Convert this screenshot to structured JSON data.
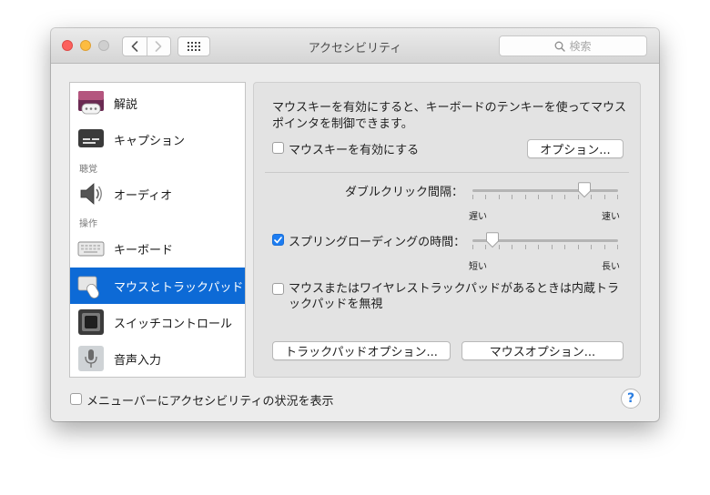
{
  "window": {
    "title": "アクセシビリティ",
    "search_placeholder": "検索"
  },
  "sidebar": {
    "items": [
      {
        "label": "解説",
        "icon": "descriptions-icon"
      },
      {
        "label": "キャプション",
        "icon": "captions-icon"
      },
      {
        "label": "オーディオ",
        "icon": "speaker-icon"
      },
      {
        "label": "キーボード",
        "icon": "keyboard-icon"
      },
      {
        "label": "マウスとトラックパッド",
        "icon": "mouse-trackpad-icon",
        "selected": true
      },
      {
        "label": "スイッチコントロール",
        "icon": "switch-control-icon"
      },
      {
        "label": "音声入力",
        "icon": "microphone-icon"
      }
    ],
    "headers": {
      "hearing": "聴覚",
      "interaction": "操作"
    }
  },
  "panel": {
    "description": "マウスキーを有効にすると、キーボードのテンキーを使ってマウスポインタを制御できます。",
    "mouse_keys_label": "マウスキーを有効にする",
    "mouse_keys_checked": false,
    "options_button": "オプション...",
    "double_click": {
      "label": "ダブルクリック間隔：",
      "min_label": "遅い",
      "max_label": "速い",
      "value_percent": 77
    },
    "spring_loading": {
      "label": "スプリングローディングの時間：",
      "checked": true,
      "min_label": "短い",
      "max_label": "長い",
      "value_percent": 14
    },
    "ignore_trackpad_label": "マウスまたはワイヤレストラックパッドがあるときは内蔵トラックパッドを無視",
    "ignore_trackpad_checked": false,
    "trackpad_options_button": "トラックパッドオプション...",
    "mouse_options_button": "マウスオプション..."
  },
  "footer": {
    "show_status_label": "メニューバーにアクセシビリティの状況を表示",
    "show_status_checked": false,
    "help_label": "?"
  },
  "colors": {
    "selection": "#0d6ad6",
    "checkbox_checked": "#1d7df2"
  }
}
